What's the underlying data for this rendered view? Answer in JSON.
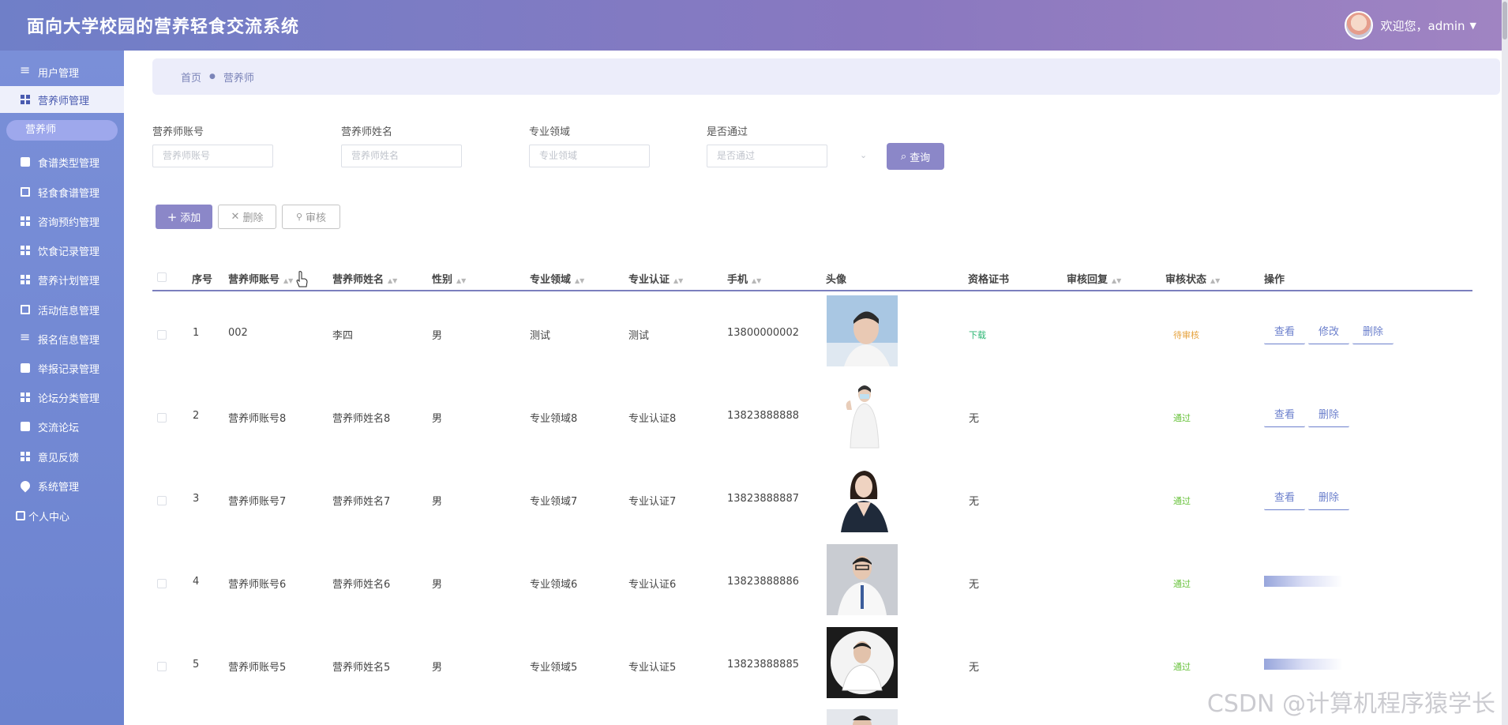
{
  "app": {
    "title": "面向大学校园的营养轻食交流系统",
    "welcome": "欢迎您，admin"
  },
  "sidebar": {
    "items": [
      {
        "label": "用户管理",
        "icon": "list-icon"
      },
      {
        "label": "营养师管理",
        "icon": "grid-icon",
        "active": true
      },
      {
        "label": "营养师",
        "icon": ""
      },
      {
        "label": "食谱类型管理",
        "icon": "book-icon"
      },
      {
        "label": "轻食食谱管理",
        "icon": "screen-icon"
      },
      {
        "label": "咨询预约管理",
        "icon": "grid-icon"
      },
      {
        "label": "饮食记录管理",
        "icon": "grid-icon"
      },
      {
        "label": "营养计划管理",
        "icon": "grid-icon"
      },
      {
        "label": "活动信息管理",
        "icon": "screen-icon"
      },
      {
        "label": "报名信息管理",
        "icon": "list-icon"
      },
      {
        "label": "举报记录管理",
        "icon": "book-icon"
      },
      {
        "label": "论坛分类管理",
        "icon": "grid-icon"
      },
      {
        "label": "交流论坛",
        "icon": "book-icon"
      },
      {
        "label": "意见反馈",
        "icon": "grid-icon"
      },
      {
        "label": "系统管理",
        "icon": "pin-icon"
      },
      {
        "label": "个人中心",
        "icon": "user-icon"
      }
    ]
  },
  "breadcrumb": {
    "home": "首页",
    "current": "营养师"
  },
  "search": {
    "fields": [
      {
        "label": "营养师账号",
        "placeholder": "营养师账号"
      },
      {
        "label": "营养师姓名",
        "placeholder": "营养师姓名"
      },
      {
        "label": "专业领域",
        "placeholder": "专业领域"
      },
      {
        "label": "是否通过",
        "placeholder": "是否通过"
      }
    ],
    "query_label": "查询"
  },
  "toolbar": {
    "add": "添加",
    "delete": "删除",
    "audit": "审核"
  },
  "table": {
    "headers": [
      "序号",
      "营养师账号",
      "营养师姓名",
      "性别",
      "专业领域",
      "专业认证",
      "手机",
      "头像",
      "资格证书",
      "审核回复",
      "审核状态",
      "操作"
    ],
    "rows": [
      {
        "no": "1",
        "account": "002",
        "name": "李四",
        "gender": "男",
        "field": "测试",
        "cert": "测试",
        "phone": "13800000002",
        "license": "下载",
        "reply": "",
        "status": "待审核",
        "actions": [
          "查看",
          "修改",
          "删除"
        ]
      },
      {
        "no": "2",
        "account": "营养师账号8",
        "name": "营养师姓名8",
        "gender": "男",
        "field": "专业领域8",
        "cert": "专业认证8",
        "phone": "13823888888",
        "license": "无",
        "reply": "",
        "status": "通过",
        "actions": [
          "查看",
          "删除"
        ]
      },
      {
        "no": "3",
        "account": "营养师账号7",
        "name": "营养师姓名7",
        "gender": "男",
        "field": "专业领域7",
        "cert": "专业认证7",
        "phone": "13823888887",
        "license": "无",
        "reply": "",
        "status": "通过",
        "actions": [
          "查看",
          "删除"
        ]
      },
      {
        "no": "4",
        "account": "营养师账号6",
        "name": "营养师姓名6",
        "gender": "男",
        "field": "专业领域6",
        "cert": "专业认证6",
        "phone": "13823888886",
        "license": "无",
        "reply": "",
        "status": "通过",
        "actions": []
      },
      {
        "no": "5",
        "account": "营养师账号5",
        "name": "营养师姓名5",
        "gender": "男",
        "field": "专业领域5",
        "cert": "专业认证5",
        "phone": "13823888885",
        "license": "无",
        "reply": "",
        "status": "通过",
        "actions": []
      }
    ]
  },
  "watermark": "CSDN @计算机程序猿学长",
  "colors": {
    "accent": "#8b87c8",
    "link": "#6b7fcc",
    "pending": "#e6a23c",
    "pass": "#67c23a",
    "download": "#2bb673"
  }
}
